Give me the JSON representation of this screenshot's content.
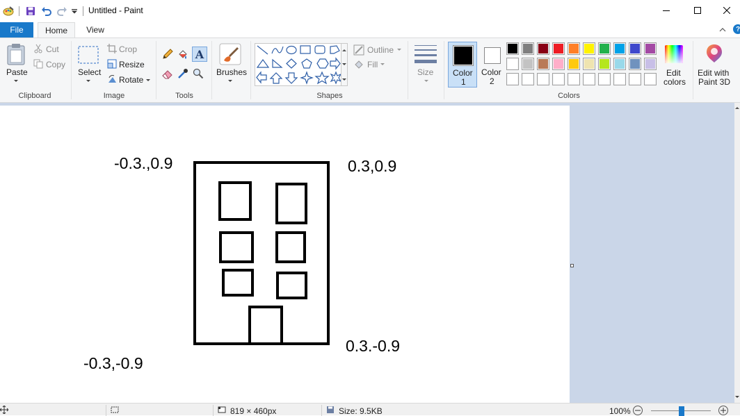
{
  "window": {
    "title": "Untitled - Paint",
    "minimize_icon": "minimize-icon",
    "maximize_icon": "maximize-icon",
    "close_icon": "close-icon"
  },
  "quick_access": {
    "icons": [
      "paint-app-icon",
      "save-icon",
      "undo-icon",
      "redo-icon",
      "customize-dropdown-icon"
    ]
  },
  "tabs": {
    "file": "File",
    "home": "Home",
    "view": "View"
  },
  "ribbon": {
    "clipboard": {
      "label": "Clipboard",
      "paste": "Paste",
      "cut": "Cut",
      "copy": "Copy"
    },
    "image": {
      "label": "Image",
      "select": "Select",
      "crop": "Crop",
      "resize": "Resize",
      "rotate": "Rotate"
    },
    "tools": {
      "label": "Tools",
      "items": [
        "pencil-icon",
        "fill-icon",
        "text-icon",
        "eraser-icon",
        "color-picker-icon",
        "magnifier-icon"
      ]
    },
    "brushes": {
      "label": "Brushes"
    },
    "shapes": {
      "label": "Shapes",
      "outline": "Outline",
      "fill": "Fill"
    },
    "size": {
      "label": "Size"
    },
    "colors": {
      "label": "Colors",
      "color1_label": "Color",
      "color1_num": "1",
      "color2_label": "Color",
      "color2_num": "2",
      "color1_value": "#000000",
      "color2_value": "#ffffff",
      "edit_colors_line1": "Edit",
      "edit_colors_line2": "colors",
      "palette_row1": [
        "#000000",
        "#7f7f7f",
        "#880015",
        "#ed1c24",
        "#ff7f27",
        "#fff200",
        "#22b14c",
        "#00a2e8",
        "#3f48cc",
        "#a349a4"
      ],
      "palette_row2": [
        "#ffffff",
        "#c3c3c3",
        "#b97a57",
        "#ffaec9",
        "#ffc90e",
        "#efe4b0",
        "#b5e61d",
        "#99d9ea",
        "#7092be",
        "#c8bfe7"
      ],
      "palette_row3": [
        "#ffffff",
        "#ffffff",
        "#ffffff",
        "#ffffff",
        "#ffffff",
        "#ffffff",
        "#ffffff",
        "#ffffff",
        "#ffffff",
        "#ffffff"
      ]
    },
    "paint3d": {
      "line1": "Edit with",
      "line2": "Paint 3D"
    }
  },
  "canvas": {
    "labels": {
      "top_left": "-0.3.,0.9",
      "top_right": "0.3,0.9",
      "bottom_right": "0.3.-0.9",
      "bottom_left": "-0.3,-0.9"
    }
  },
  "status": {
    "dimensions": "819 × 460px",
    "size": "Size: 9.5KB",
    "zoom": "100%"
  }
}
